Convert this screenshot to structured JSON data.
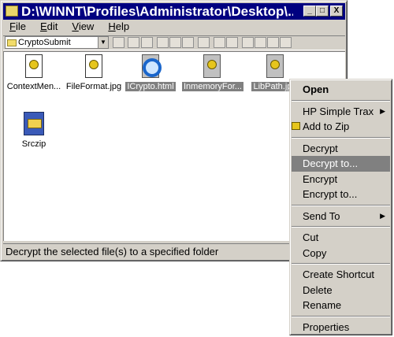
{
  "window": {
    "title": "D:\\WINNT\\Profiles\\Administrator\\Desktop\\...",
    "buttons": {
      "minimize": "_",
      "maximize": "□",
      "close": "X"
    }
  },
  "menubar": [
    "File",
    "Edit",
    "View",
    "Help"
  ],
  "toolbar": {
    "address": "CryptoSubmit"
  },
  "files": [
    {
      "name": "ContextMen...",
      "icon": "context-doc-icon",
      "selected": false
    },
    {
      "name": "FileFormat.jpg",
      "icon": "jpg-doc-icon",
      "selected": false
    },
    {
      "name": "ICrypto.html",
      "icon": "ie-html-icon",
      "selected": true
    },
    {
      "name": "InmemoryFor...",
      "icon": "gray-doc-icon",
      "selected": true
    },
    {
      "name": "LibPath.jpg",
      "icon": "gray-doc-icon",
      "selected": true
    },
    {
      "name": "Srczip",
      "icon": "zip-archive-icon",
      "selected": false
    }
  ],
  "status": "Decrypt the selected file(s) to a specified folder",
  "context_menu": {
    "open": "Open",
    "hp_simple_trax": "HP Simple Trax",
    "add_to_zip": "Add to Zip",
    "decrypt": "Decrypt",
    "decrypt_to": "Decrypt to...",
    "encrypt": "Encrypt",
    "encrypt_to": "Encrypt to...",
    "send_to": "Send To",
    "cut": "Cut",
    "copy": "Copy",
    "create_shortcut": "Create Shortcut",
    "delete": "Delete",
    "rename": "Rename",
    "properties": "Properties",
    "highlighted": "Decrypt to..."
  }
}
